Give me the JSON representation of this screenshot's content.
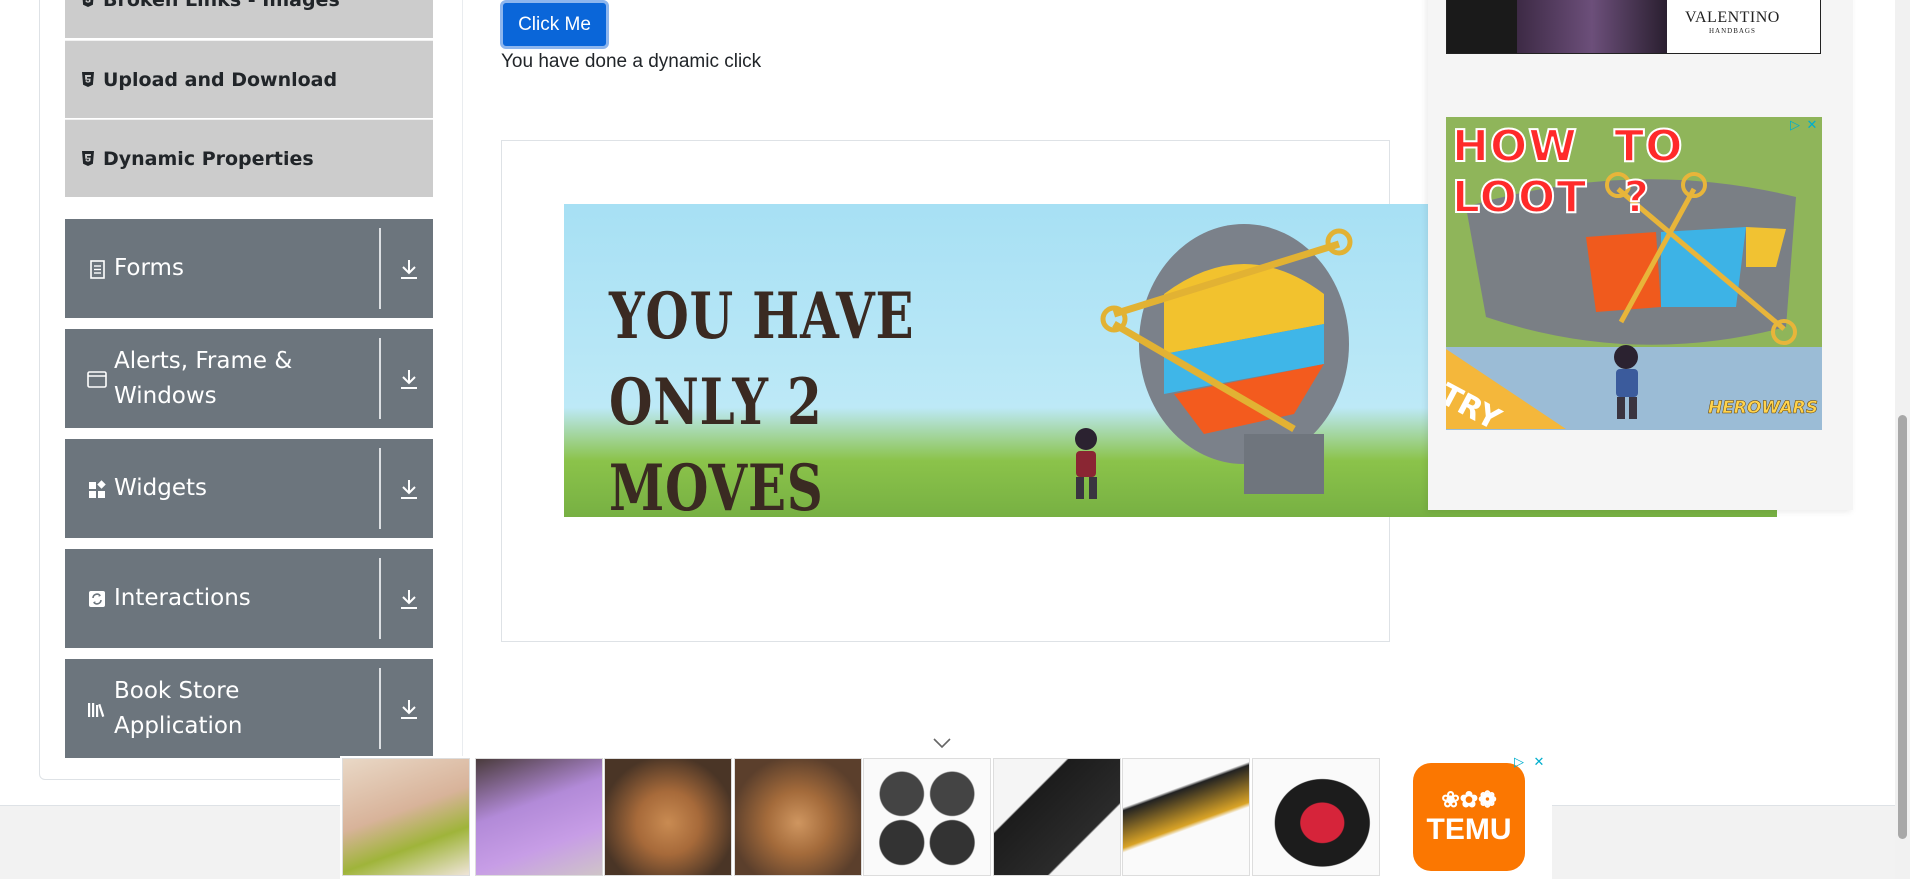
{
  "sidebar": {
    "sub_items": [
      {
        "label": "Broken Links - Images"
      },
      {
        "label": "Upload and Download"
      },
      {
        "label": "Dynamic Properties"
      }
    ],
    "groups": [
      {
        "label": "Forms",
        "icon": "form-icon"
      },
      {
        "label": "Alerts, Frame & Windows",
        "icon": "window-icon"
      },
      {
        "label": "Widgets",
        "icon": "widgets-icon"
      },
      {
        "label": "Interactions",
        "icon": "interactions-icon"
      },
      {
        "label": "Book Store Application",
        "icon": "books-icon"
      }
    ]
  },
  "main": {
    "click_button_label": "Click Me",
    "dynamic_click_message": "You have done a dynamic click"
  },
  "ads": {
    "banner_headline": "YOU HAVE ONLY 2 MOVES",
    "handbag_brand": "VALENTINO",
    "handbag_sub": "HANDBAGS",
    "game_headline": "HOW TO LOOT ?",
    "game_cta": "TRY",
    "game_brand": "HEROWARS",
    "temu_brand": "TEMU"
  },
  "colors": {
    "accent": "#0a66d9",
    "sidebar_group": "#6c757d",
    "sidebar_subitem": "#cccccc",
    "temu": "#fb7701"
  }
}
